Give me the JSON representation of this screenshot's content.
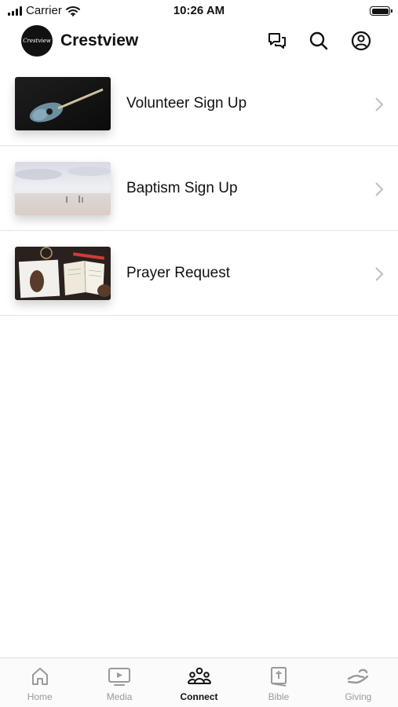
{
  "status_bar": {
    "carrier": "Carrier",
    "time": "10:26 AM"
  },
  "header": {
    "logo_text": "Crestview",
    "title": "Crestview"
  },
  "items": [
    {
      "label": "Volunteer Sign Up"
    },
    {
      "label": "Baptism Sign Up"
    },
    {
      "label": "Prayer Request"
    }
  ],
  "tabs": [
    {
      "label": "Home"
    },
    {
      "label": "Media"
    },
    {
      "label": "Connect",
      "active": true
    },
    {
      "label": "Bible"
    },
    {
      "label": "Giving"
    }
  ],
  "colors": {
    "tab_active": "#111111",
    "tab_inactive": "#9a9a9a",
    "divider": "#e4e4e4"
  },
  "icons": [
    "chat-icon",
    "search-icon",
    "profile-icon",
    "chevron-right-icon",
    "home-icon",
    "media-icon",
    "connect-icon",
    "bible-icon",
    "giving-icon"
  ]
}
